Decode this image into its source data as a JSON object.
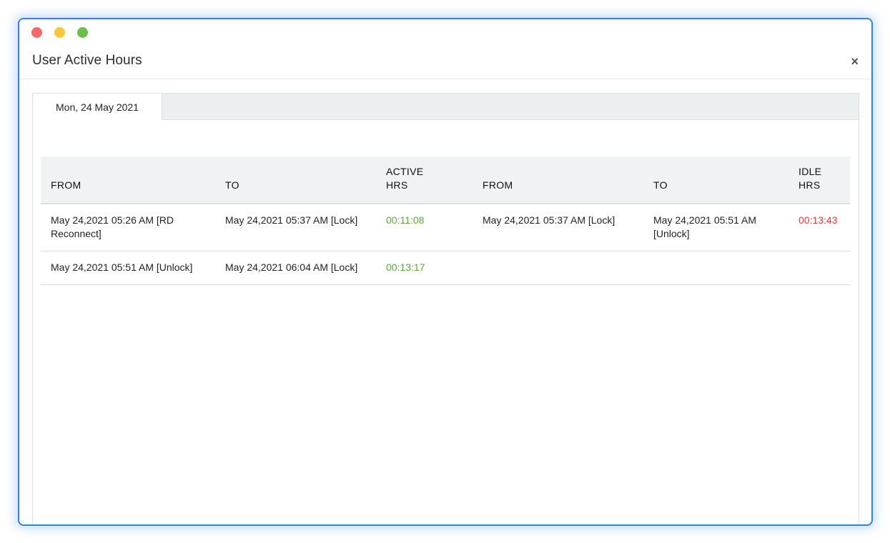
{
  "window": {
    "title": "User Active Hours",
    "close_label": "×"
  },
  "tabs": [
    {
      "label": "Mon, 24 May 2021"
    }
  ],
  "table": {
    "headers": {
      "from1": "FROM",
      "to1": "TO",
      "active_line1": "ACTIVE",
      "active_line2": "HRS",
      "from2": "FROM",
      "to2": "TO",
      "idle_line1": "IDLE",
      "idle_line2": "HRS"
    },
    "rows": [
      {
        "from1": "May 24,2021 05:26 AM [RD Reconnect]",
        "to1": "May 24,2021 05:37 AM [Lock]",
        "active": "00:11:08",
        "from2": "May 24,2021 05:37 AM [Lock]",
        "to2": "May 24,2021 05:51 AM [Unlock]",
        "idle": "00:13:43"
      },
      {
        "from1": "May 24,2021 05:51 AM [Unlock]",
        "to1": "May 24,2021 06:04 AM [Lock]",
        "active": "00:13:17",
        "from2": "",
        "to2": "",
        "idle": ""
      }
    ]
  },
  "colors": {
    "window_border": "#2f86e0",
    "active_text": "#5aa83a",
    "idle_text": "#e0393b",
    "close_dot": "#f76868",
    "minimize_dot": "#f7c83b",
    "maximize_dot": "#6cc04a"
  }
}
